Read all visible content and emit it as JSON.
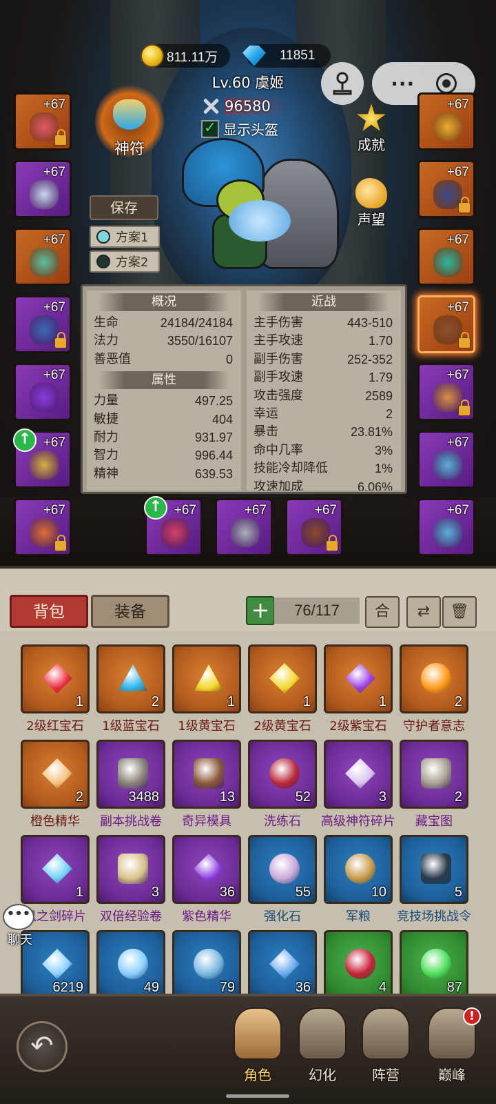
{
  "currency": {
    "gold": "811.11万",
    "gems": "11851"
  },
  "player": {
    "title": "Lv.60 虞姬",
    "power": "96580",
    "show_helmet_label": "显示头盔",
    "show_helmet_checked": true
  },
  "rune_label": "神符",
  "actions": {
    "achievement": "成就",
    "reputation": "声望"
  },
  "save_label": "保存",
  "plans": [
    {
      "label": "方案1",
      "color": "#7fd6dc"
    },
    {
      "label": "方案2",
      "color": "#1f3a2a"
    }
  ],
  "slots": {
    "left": [
      {
        "level": "+67",
        "rarity": "orange",
        "locked": true,
        "upgrade": false
      },
      {
        "level": "+67",
        "rarity": "purple",
        "locked": false,
        "upgrade": false
      },
      {
        "level": "+67",
        "rarity": "orange",
        "locked": false,
        "upgrade": false
      },
      {
        "level": "+67",
        "rarity": "purple",
        "locked": true,
        "upgrade": false
      },
      {
        "level": "+67",
        "rarity": "purple",
        "locked": false,
        "upgrade": false
      },
      {
        "level": "+67",
        "rarity": "purple",
        "locked": false,
        "upgrade": true
      },
      {
        "level": "+67",
        "rarity": "purple",
        "locked": true,
        "upgrade": false
      }
    ],
    "right": [
      {
        "level": "+67",
        "rarity": "orange",
        "locked": false,
        "upgrade": false
      },
      {
        "level": "+67",
        "rarity": "orange",
        "locked": true,
        "upgrade": false
      },
      {
        "level": "+67",
        "rarity": "orange",
        "locked": false,
        "upgrade": false
      },
      {
        "level": "+67",
        "rarity": "orange",
        "locked": true,
        "upgrade": false
      },
      {
        "level": "+67",
        "rarity": "purple",
        "locked": true,
        "upgrade": false
      },
      {
        "level": "+67",
        "rarity": "purple",
        "locked": false,
        "upgrade": false
      },
      {
        "level": "+67",
        "rarity": "purple",
        "locked": false,
        "upgrade": false
      }
    ],
    "bottom": [
      {
        "level": "+67",
        "rarity": "purple",
        "locked": false,
        "upgrade": true
      },
      {
        "level": "+67",
        "rarity": "purple",
        "locked": false,
        "upgrade": false
      },
      {
        "level": "+67",
        "rarity": "purple",
        "locked": true,
        "upgrade": false
      }
    ]
  },
  "stats": {
    "overview_title": "概况",
    "overview": [
      {
        "label": "生命",
        "value": "24184/24184"
      },
      {
        "label": "法力",
        "value": "3550/16107"
      },
      {
        "label": "善恶值",
        "value": "0"
      }
    ],
    "attributes_title": "属性",
    "attributes": [
      {
        "label": "力量",
        "value": "497.25"
      },
      {
        "label": "敏捷",
        "value": "404"
      },
      {
        "label": "耐力",
        "value": "931.97"
      },
      {
        "label": "智力",
        "value": "996.44"
      },
      {
        "label": "精神",
        "value": "639.53"
      }
    ],
    "melee_title": "近战",
    "melee": [
      {
        "label": "主手伤害",
        "value": "443-510"
      },
      {
        "label": "主手攻速",
        "value": "1.70"
      },
      {
        "label": "副手伤害",
        "value": "252-352"
      },
      {
        "label": "副手攻速",
        "value": "1.79"
      },
      {
        "label": "攻击强度",
        "value": "2589"
      },
      {
        "label": "幸运",
        "value": "2"
      },
      {
        "label": "暴击",
        "value": "23.81%"
      },
      {
        "label": "命中几率",
        "value": "3%"
      },
      {
        "label": "技能冷却降低",
        "value": "1%"
      },
      {
        "label": "攻速加成",
        "value": "6.06%"
      }
    ]
  },
  "bag": {
    "tab_bag": "背包",
    "tab_equip": "装备",
    "add": "+",
    "capacity": "76/117",
    "merge": "合",
    "refresh": "⇄",
    "trash": "🗑",
    "items": [
      {
        "name": "2级红宝石",
        "count": "1",
        "rarity": "orange",
        "icon": "gem-d",
        "color": "#e8283a"
      },
      {
        "name": "1级蓝宝石",
        "count": "2",
        "rarity": "orange",
        "icon": "gem-t",
        "color": "#2ab4f0"
      },
      {
        "name": "1级黄宝石",
        "count": "1",
        "rarity": "orange",
        "icon": "gem-t",
        "color": "#f2d82a"
      },
      {
        "name": "2级黄宝石",
        "count": "1",
        "rarity": "orange",
        "icon": "gem-d",
        "color": "#f2d82a"
      },
      {
        "name": "2级紫宝石",
        "count": "1",
        "rarity": "orange",
        "icon": "gem-d",
        "color": "#9a3ae0"
      },
      {
        "name": "守护者意志",
        "count": "2",
        "rarity": "orange",
        "icon": "round",
        "color": "#ff9a1a"
      },
      {
        "name": "橙色精华",
        "count": "2",
        "rarity": "orange",
        "icon": "gem-d",
        "color": "#f6c080"
      },
      {
        "name": "副本挑战卷",
        "count": "3488",
        "rarity": "purple",
        "icon": "box",
        "color": "#8a8478"
      },
      {
        "name": "奇异模具",
        "count": "13",
        "rarity": "purple",
        "icon": "box",
        "color": "#8a5a3a"
      },
      {
        "name": "洗练石",
        "count": "52",
        "rarity": "purple",
        "icon": "round",
        "color": "#b8283a"
      },
      {
        "name": "高级神符碎片",
        "count": "3",
        "rarity": "purple",
        "icon": "gem-d",
        "color": "#d8c4f0"
      },
      {
        "name": "藏宝图",
        "count": "2",
        "rarity": "purple",
        "icon": "box",
        "color": "#a8a090"
      },
      {
        "name": "风之剑碎片",
        "count": "1",
        "rarity": "purple",
        "icon": "gem-d",
        "color": "#6ad0f0"
      },
      {
        "name": "双倍经验卷",
        "count": "3",
        "rarity": "purple",
        "icon": "box",
        "color": "#d8c48a"
      },
      {
        "name": "紫色精华",
        "count": "36",
        "rarity": "purple",
        "icon": "gem-d",
        "color": "#8a3ae0"
      },
      {
        "name": "强化石",
        "count": "55",
        "rarity": "blue",
        "icon": "round",
        "color": "#c8a8d8"
      },
      {
        "name": "军粮",
        "count": "10",
        "rarity": "blue",
        "icon": "round",
        "color": "#c89a48"
      },
      {
        "name": "竞技场挑战令",
        "count": "5",
        "rarity": "blue",
        "icon": "box",
        "color": "#2a3a4a"
      },
      {
        "name": "",
        "count": "6219",
        "rarity": "blue",
        "icon": "gem-d",
        "color": "#8ad0ff"
      },
      {
        "name": "",
        "count": "49",
        "rarity": "blue",
        "icon": "round",
        "color": "#8ad0ff"
      },
      {
        "name": "",
        "count": "79",
        "rarity": "blue",
        "icon": "round",
        "color": "#7ab8e0"
      },
      {
        "name": "",
        "count": "36",
        "rarity": "blue",
        "icon": "gem-d",
        "color": "#6aa8f0"
      },
      {
        "name": "",
        "count": "4",
        "rarity": "green",
        "icon": "round",
        "color": "#c8203a"
      },
      {
        "name": "",
        "count": "87",
        "rarity": "green",
        "icon": "round",
        "color": "#4ee05a"
      }
    ]
  },
  "chat_label": "聊天",
  "chat_bubble": "•••",
  "nav": [
    {
      "label": "角色",
      "active": true
    },
    {
      "label": "幻化",
      "active": false
    },
    {
      "label": "阵营",
      "active": false
    },
    {
      "label": "巅峰",
      "active": false,
      "badge": "!"
    }
  ]
}
